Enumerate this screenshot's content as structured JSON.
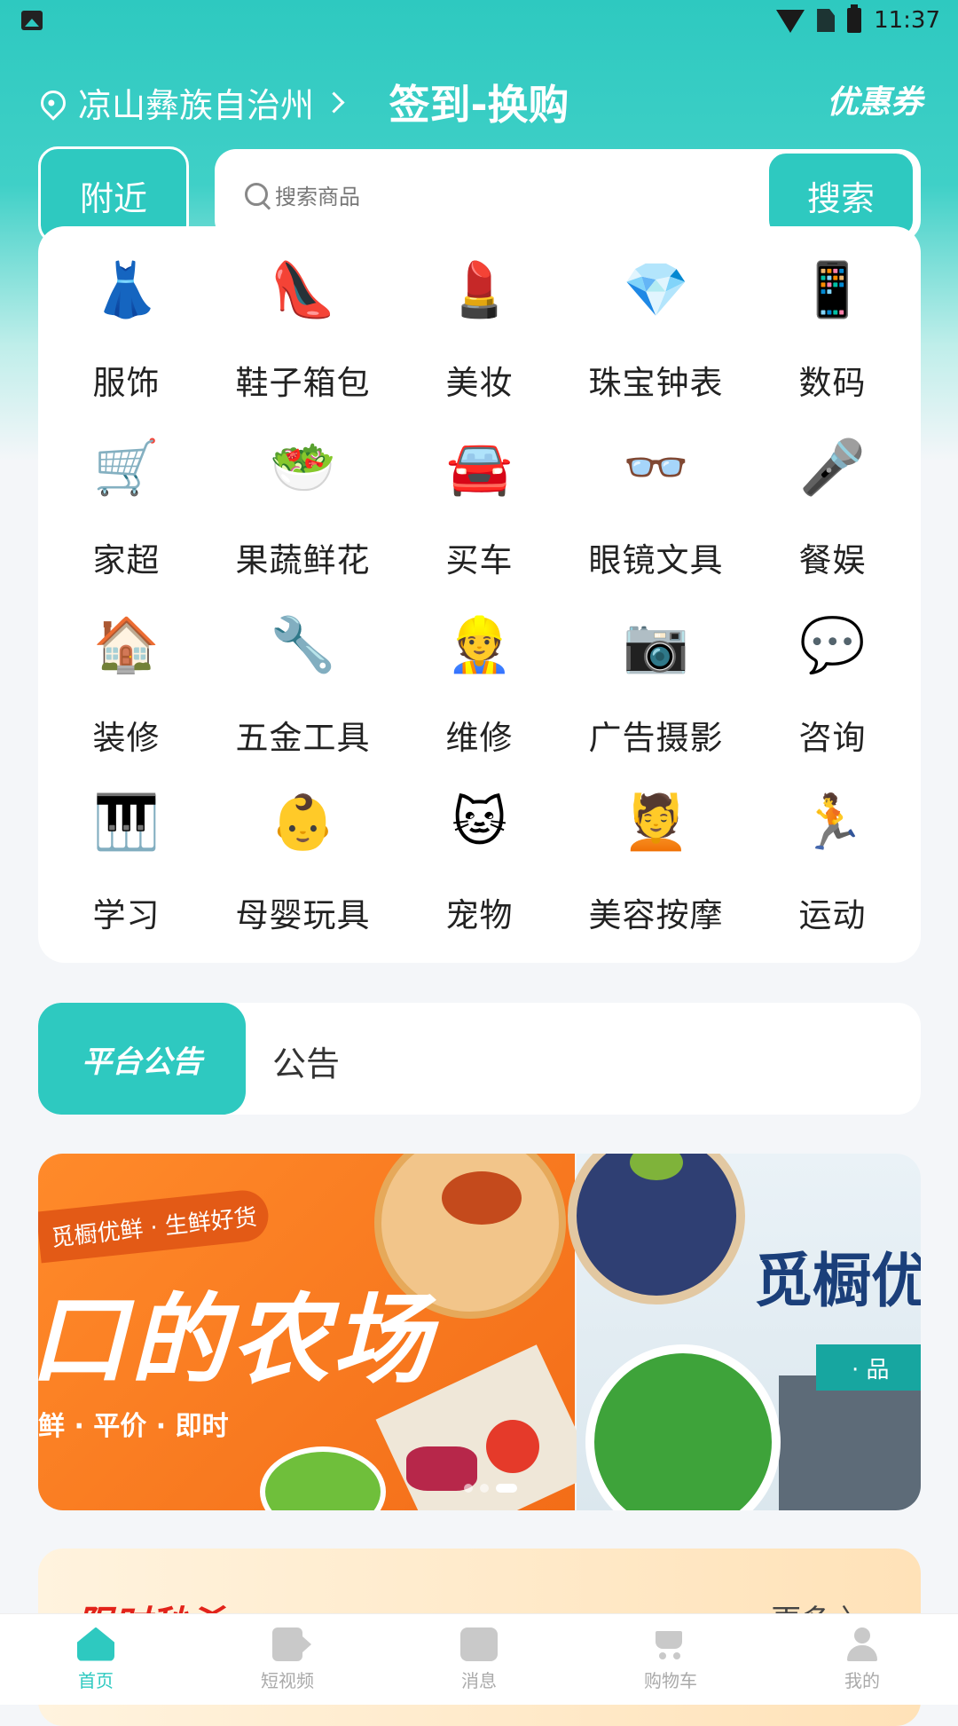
{
  "status_bar": {
    "time": "11:37",
    "icons": [
      "gallery-icon",
      "wifi-icon",
      "no-sim-icon",
      "battery-icon"
    ]
  },
  "header": {
    "location": "凉山彝族自治州",
    "title": "签到-换购",
    "coupon": "优惠券"
  },
  "search": {
    "nearby_label": "附近",
    "placeholder": "搜索商品",
    "button_label": "搜索"
  },
  "categories": [
    {
      "label": "服饰",
      "icon": "dress-icon",
      "glyph": "👗"
    },
    {
      "label": "鞋子箱包",
      "icon": "shoes-bag-icon",
      "glyph": "👠"
    },
    {
      "label": "美妆",
      "icon": "cosmetics-icon",
      "glyph": "💄"
    },
    {
      "label": "珠宝钟表",
      "icon": "jewelry-icon",
      "glyph": "💎"
    },
    {
      "label": "数码",
      "icon": "phone-icon",
      "glyph": "📱"
    },
    {
      "label": "家超",
      "icon": "shopping-cart-icon",
      "glyph": "🛒"
    },
    {
      "label": "果蔬鲜花",
      "icon": "fruit-basket-icon",
      "glyph": "🥗"
    },
    {
      "label": "买车",
      "icon": "car-icon",
      "glyph": "🚘"
    },
    {
      "label": "眼镜文具",
      "icon": "glasses-icon",
      "glyph": "👓"
    },
    {
      "label": "餐娱",
      "icon": "dining-mic-icon",
      "glyph": "🎤"
    },
    {
      "label": "装修",
      "icon": "house-paint-icon",
      "glyph": "🏠"
    },
    {
      "label": "五金工具",
      "icon": "tape-measure-icon",
      "glyph": "🔧"
    },
    {
      "label": "维修",
      "icon": "repairman-icon",
      "glyph": "👷"
    },
    {
      "label": "广告摄影",
      "icon": "camera-icon",
      "glyph": "📷"
    },
    {
      "label": "咨询",
      "icon": "consultant-icon",
      "glyph": "💬"
    },
    {
      "label": "学习",
      "icon": "piano-icon",
      "glyph": "🎹"
    },
    {
      "label": "母婴玩具",
      "icon": "baby-icon",
      "glyph": "👶"
    },
    {
      "label": "宠物",
      "icon": "cat-icon",
      "glyph": "🐱"
    },
    {
      "label": "美容按摩",
      "icon": "massage-icon",
      "glyph": "💆"
    },
    {
      "label": "运动",
      "icon": "running-icon",
      "glyph": "🏃"
    }
  ],
  "notice": {
    "badge": "平台公告",
    "text": "公告"
  },
  "banner": {
    "slide_a": {
      "tag": "觅橱优鲜 · 生鲜好货",
      "headline": "口的农场",
      "subline": "鲜 · 平价 · 即时"
    },
    "slide_b": {
      "brand": "觅橱优",
      "ribbon": "· 品"
    },
    "active_dot": 2,
    "dot_count": 3
  },
  "flash_sale": {
    "title": "限时秒杀",
    "more": "更多 〉"
  },
  "bottom_nav": [
    {
      "label": "首页",
      "icon": "home-icon",
      "active": true
    },
    {
      "label": "短视频",
      "icon": "video-icon",
      "active": false
    },
    {
      "label": "消息",
      "icon": "message-icon",
      "active": false
    },
    {
      "label": "购物车",
      "icon": "cart-icon",
      "active": false
    },
    {
      "label": "我的",
      "icon": "profile-icon",
      "active": false
    }
  ],
  "colors": {
    "accent": "#2ec9c0",
    "flash_red": "#e2231a",
    "banner_orange": "#f36d18"
  }
}
